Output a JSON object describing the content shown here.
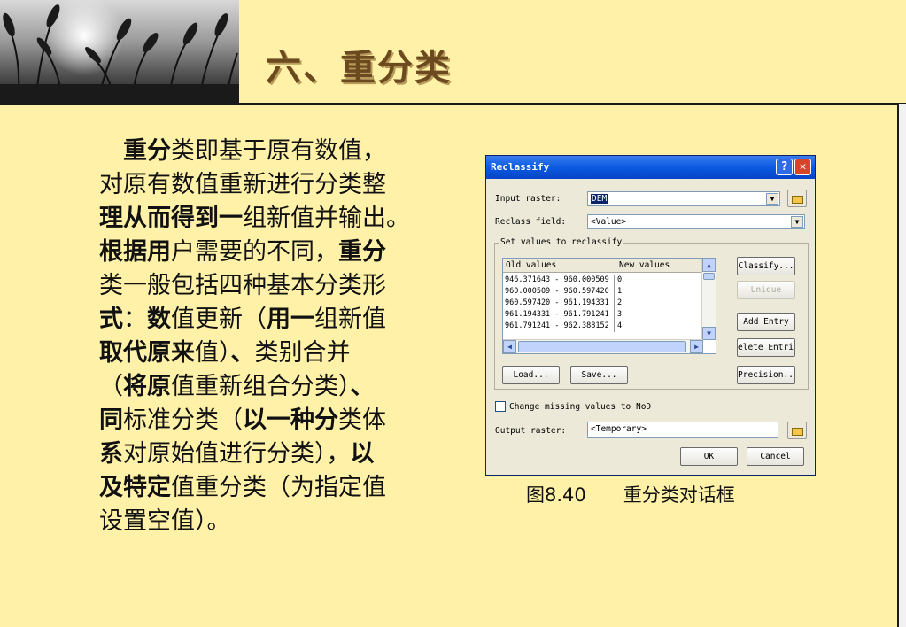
{
  "slide": {
    "title": "六、重分类",
    "paragraph": [
      [
        {
          "t": "　",
          "b": false
        },
        {
          "t": "重分",
          "b": true
        },
        {
          "t": "类即基于原有数值，",
          "b": false
        }
      ],
      [
        {
          "t": "对原有数值重新进行分类整",
          "b": false
        }
      ],
      [
        {
          "t": "理从而得到一",
          "b": true
        },
        {
          "t": "组新值并输出。",
          "b": false
        }
      ],
      [
        {
          "t": "根据用",
          "b": true
        },
        {
          "t": "户需要的不同，",
          "b": false
        },
        {
          "t": "重分",
          "b": true
        }
      ],
      [
        {
          "t": "类一般包括四种基本分类形",
          "b": false
        }
      ],
      [
        {
          "t": "式",
          "b": true
        },
        {
          "t": "：",
          "b": false
        },
        {
          "t": "数",
          "b": true
        },
        {
          "t": "值更新（",
          "b": false
        },
        {
          "t": "用一",
          "b": true
        },
        {
          "t": "组新值",
          "b": false
        }
      ],
      [
        {
          "t": "取代原来",
          "b": true
        },
        {
          "t": "值）",
          "b": false
        },
        {
          "t": "、",
          "b": true
        },
        {
          "t": "类别合并",
          "b": false
        }
      ],
      [
        {
          "t": "（",
          "b": false
        },
        {
          "t": "将原",
          "b": true
        },
        {
          "t": "值重新组合分类）",
          "b": false
        },
        {
          "t": "、",
          "b": true
        }
      ],
      [
        {
          "t": "同",
          "b": true
        },
        {
          "t": "标准分类（",
          "b": false
        },
        {
          "t": "以一种分",
          "b": true
        },
        {
          "t": "类体",
          "b": false
        }
      ],
      [
        {
          "t": "系",
          "b": true
        },
        {
          "t": "对原始值进行分类），",
          "b": false
        },
        {
          "t": "以",
          "b": true
        }
      ],
      [
        {
          "t": "及特定",
          "b": true
        },
        {
          "t": "值重分类（为指定值",
          "b": false
        }
      ],
      [
        {
          "t": "设置空值）。",
          "b": false
        }
      ]
    ],
    "caption": "图8.40　　重分类对话框"
  },
  "dialog": {
    "title": "Reclassify",
    "help_label": "?",
    "close_label": "✕",
    "input_raster_label": "Input raster:",
    "input_raster_value": "DEM",
    "reclass_field_label": "Reclass field:",
    "reclass_field_value": "<Value>",
    "group_label": "Set values to reclassify",
    "col_old": "Old values",
    "col_new": "New values",
    "rows": [
      {
        "old": "946.371643 - 960.000509",
        "new": "0"
      },
      {
        "old": "960.000509 - 960.597420",
        "new": "1"
      },
      {
        "old": "960.597420 - 961.194331",
        "new": "2"
      },
      {
        "old": "961.194331 - 961.791241",
        "new": "3"
      },
      {
        "old": "961.791241 - 962.388152",
        "new": "4"
      }
    ],
    "classify_label": "Classify...",
    "unique_label": "Unique",
    "add_entry_label": "Add Entry",
    "delete_entries_label": "elete Entrie",
    "load_label": "Load...",
    "save_label": "Save...",
    "precision_label": "Precision...",
    "missing_label": "Change missing values to NoD",
    "output_raster_label": "Output raster:",
    "output_raster_value": "<Temporary>",
    "ok_label": "OK",
    "cancel_label": "Cancel"
  }
}
